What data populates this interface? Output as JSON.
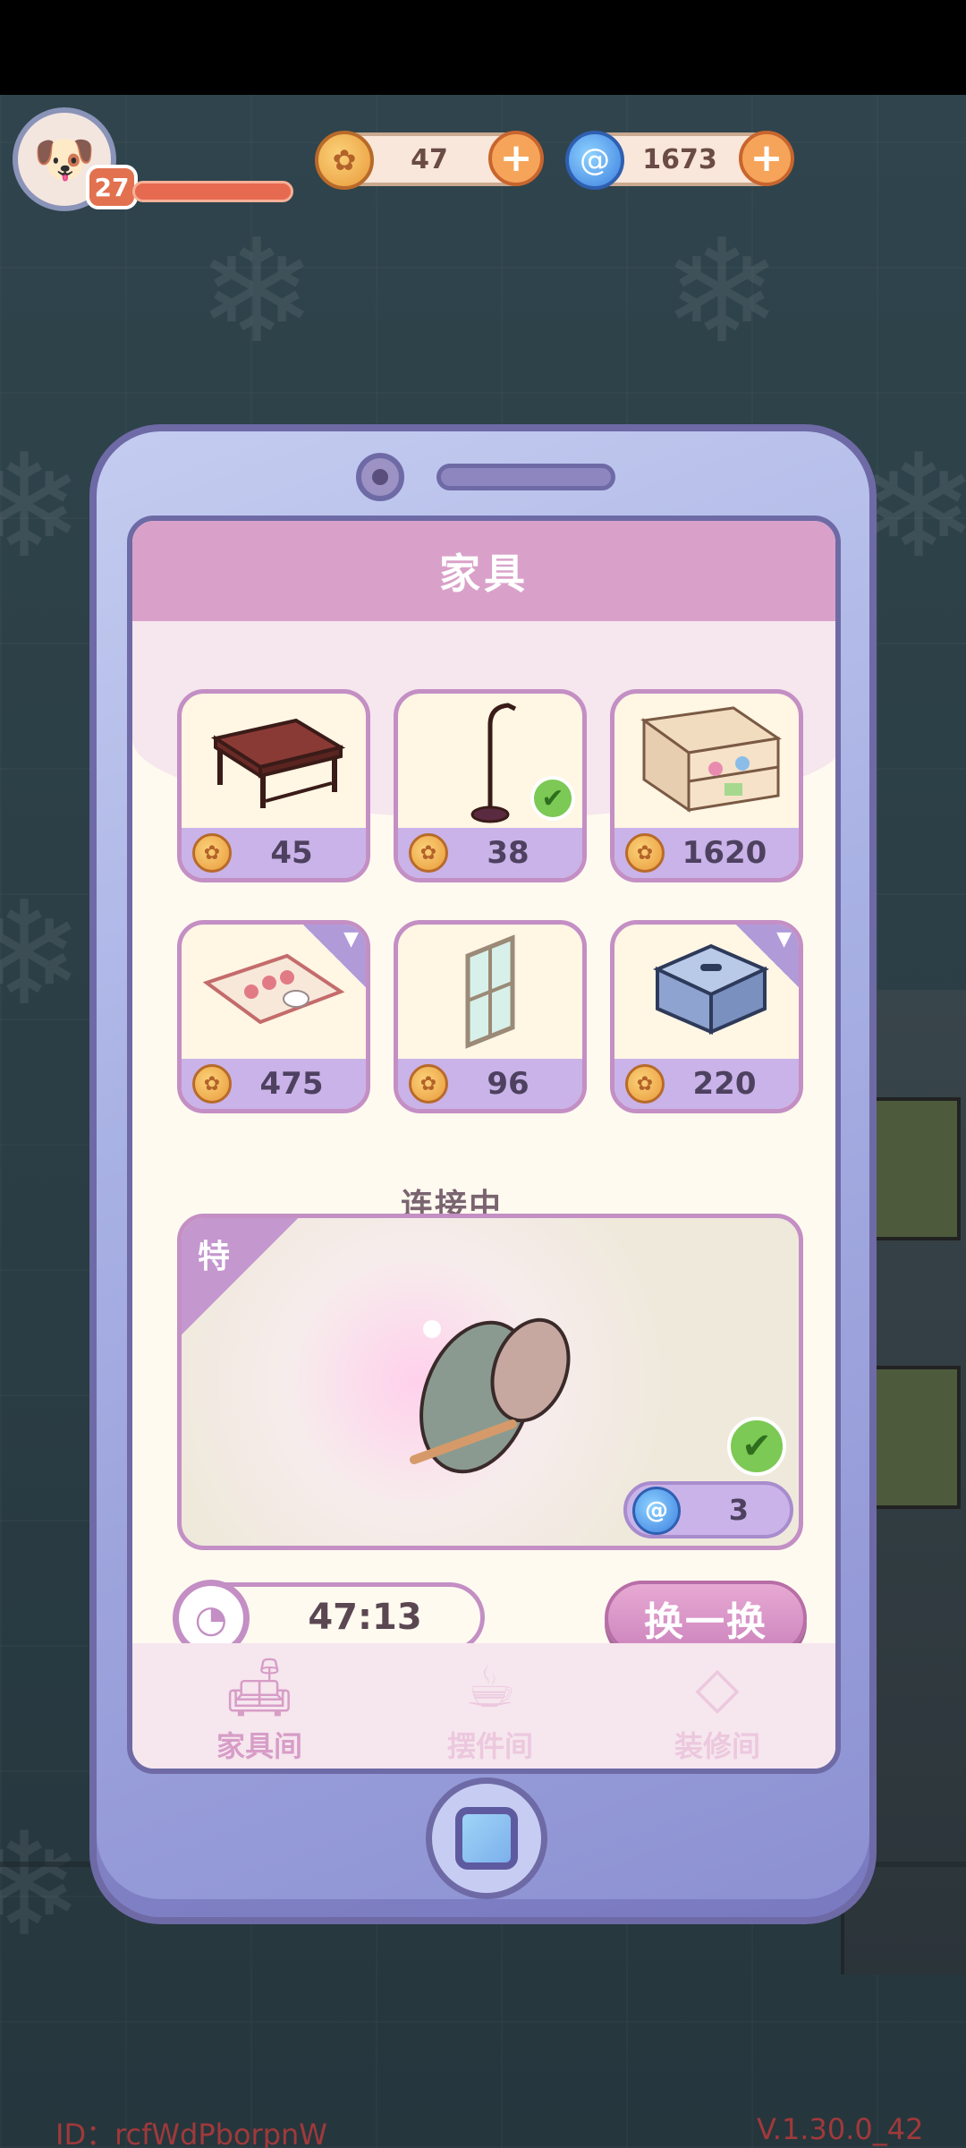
{
  "hud": {
    "level": "27",
    "coins": "47",
    "gems": "1673"
  },
  "panel": {
    "title": "家具",
    "status": "连接中",
    "items": [
      {
        "price": "45",
        "icon": "table",
        "owned": false
      },
      {
        "price": "38",
        "icon": "floor-lamp",
        "owned": true
      },
      {
        "price": "1620",
        "icon": "shelf",
        "owned": false
      },
      {
        "price": "475",
        "icon": "rug",
        "owned": false,
        "tag": "brush"
      },
      {
        "price": "96",
        "icon": "window",
        "owned": false
      },
      {
        "price": "220",
        "icon": "stool",
        "owned": false,
        "tag": "brush"
      }
    ],
    "special": {
      "tag": "特",
      "price": "3",
      "owned": true
    },
    "timer": "47:13",
    "refresh_label": "换一换",
    "tabs": [
      {
        "label": "家具间",
        "active": true
      },
      {
        "label": "摆件间",
        "active": false
      },
      {
        "label": "装修间",
        "active": false
      }
    ]
  },
  "footer": {
    "id": "ID：rcfWdPborpnW",
    "version": "V.1.30.0_42"
  }
}
